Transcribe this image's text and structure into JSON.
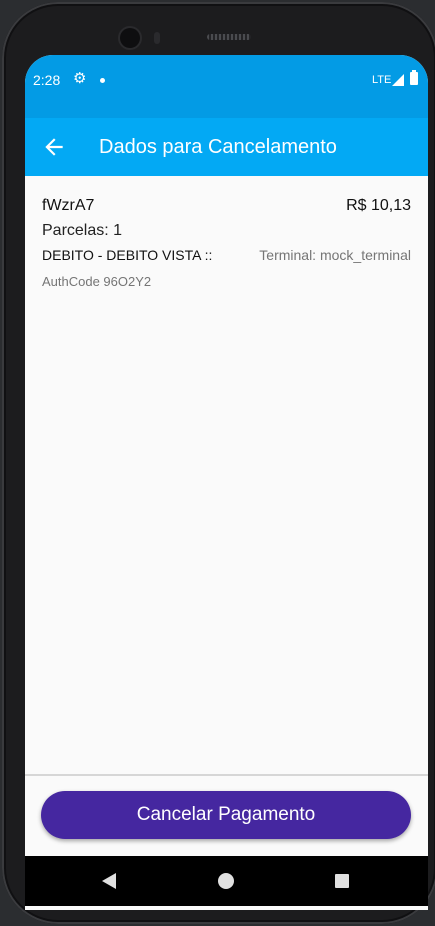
{
  "status_bar": {
    "time": "2:28",
    "network": "LTE",
    "icons": [
      "gear-icon",
      "notification-dot-icon",
      "signal-icon",
      "battery-icon"
    ]
  },
  "app_bar": {
    "title": "Dados para Cancelamento",
    "back_icon": "arrow-left-icon",
    "color": "#03a9f4",
    "status_color": "#039be5"
  },
  "transaction": {
    "id": "fWzrA7",
    "amount": "R$ 10,13",
    "installments": "Parcelas: 1",
    "payment_type": "DEBITO - DEBITO VISTA ::",
    "terminal": "Terminal: mock_terminal",
    "auth_code": "AuthCode 96O2Y2"
  },
  "actions": {
    "cancel_label": "Cancelar Pagamento",
    "cancel_color": "#4527a0"
  },
  "nav_bar": {
    "icons": [
      "back-triangle-icon",
      "home-circle-icon",
      "recents-square-icon"
    ]
  }
}
